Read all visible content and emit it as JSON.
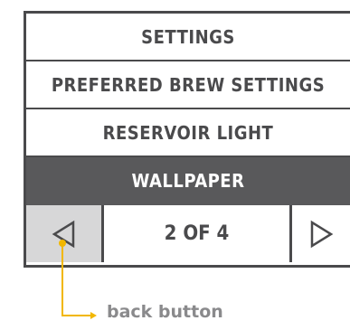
{
  "menu": {
    "items": [
      {
        "label": "SETTINGS"
      },
      {
        "label": "PREFERRED BREW SETTINGS"
      },
      {
        "label": "RESERVOIR LIGHT"
      },
      {
        "label": "WALLPAPER",
        "selected": true
      }
    ]
  },
  "pager": {
    "counter": "2 OF 4",
    "back_icon": "left-triangle-icon",
    "forward_icon": "right-triangle-icon"
  },
  "annotation": {
    "label": "back button",
    "color": "#f2b700"
  },
  "colors": {
    "frame": "#4a4a4c",
    "selected_bg": "#59595b",
    "back_bg": "#d7d7d8",
    "annotation": "#f2b700"
  }
}
